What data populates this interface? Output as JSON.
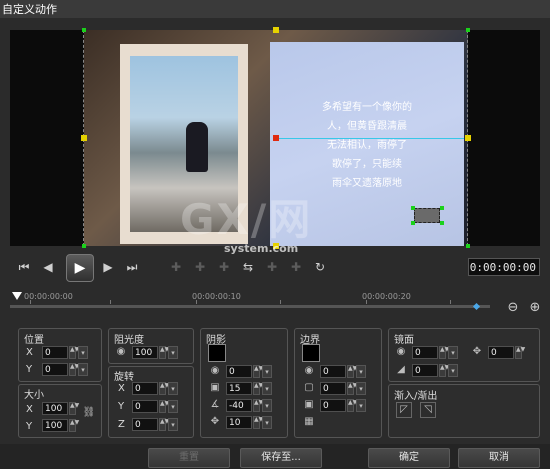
{
  "window": {
    "title": "自定义动作"
  },
  "preview": {
    "poem_lines": [
      "多希望有一个像你的",
      "人，但黄昏跟清晨",
      "无法相认，雨停了",
      "歌停了，只能续",
      "雨伞又遗落原地"
    ],
    "watermark_big": "GX/网",
    "watermark_small": "system.com",
    "guide_color": "#38c8e8"
  },
  "transport": {
    "buttons": [
      "go-to-start",
      "previous-frame",
      "play",
      "next-frame",
      "go-to-end"
    ],
    "timecode": "0:00:00:00"
  },
  "timeline": {
    "labels": [
      "00:00:00:00",
      "00:00:00:10",
      "00:00:00:20"
    ]
  },
  "panels": {
    "position": {
      "title": "位置",
      "x_label": "X",
      "x": "0",
      "y_label": "Y",
      "y": "0"
    },
    "size": {
      "title": "大小",
      "x_label": "X",
      "x": "100",
      "y_label": "Y",
      "y": "100"
    },
    "opacity": {
      "title": "阻光度",
      "value": "100"
    },
    "rotation": {
      "title": "旋转",
      "x_label": "X",
      "x": "0",
      "y_label": "Y",
      "y": "0",
      "z_label": "Z",
      "z": "0"
    },
    "shadow": {
      "title": "阴影",
      "opacity": "0",
      "blur": "15",
      "angle": "-40",
      "distance": "10",
      "color": "#000000"
    },
    "border": {
      "title": "边界",
      "opacity": "0",
      "width": "0",
      "blur": "0",
      "color": "#000000"
    },
    "mirror": {
      "title": "镜面",
      "opacity": "0",
      "distance": "0",
      "fade": "0"
    },
    "fade": {
      "title": "渐入/渐出"
    }
  },
  "footer": {
    "reset": "重置",
    "save_as": "保存至...",
    "ok": "确定",
    "cancel": "取消"
  }
}
